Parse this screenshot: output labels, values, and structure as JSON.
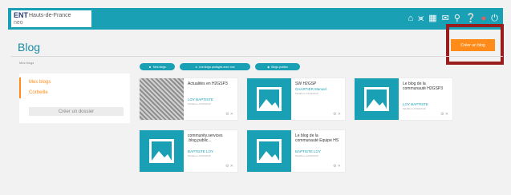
{
  "navbar": {
    "brand": "ENT",
    "region": "Hauts-de-France",
    "sub": "neo",
    "icons": [
      "home-icon",
      "share-icon",
      "apps-grid-icon",
      "messages-icon",
      "search-icon",
      "help-icon",
      "profile-icon",
      "power-icon"
    ]
  },
  "page": {
    "title": "Blog"
  },
  "actions": {
    "create_blog": "Créer un blog"
  },
  "sidebar": {
    "heading": "Mes blogs",
    "items": [
      {
        "label": "Mes blogs",
        "active": true
      },
      {
        "label": "Corbeille"
      }
    ],
    "new_folder": "Créer un dossier"
  },
  "toolbar": {
    "buttons": [
      {
        "label": "Mes blogs",
        "icon": "user-icon"
      },
      {
        "label": "Les blogs partagés avec moi",
        "icon": "share-icon"
      },
      {
        "label": "Blogs publics",
        "icon": "globe-icon"
      }
    ]
  },
  "blogs": [
    {
      "title": "Actualités en H2GSP3",
      "author": "LOY BAPTISTE",
      "date": "Modifié le 04/04/2019",
      "thumb": "photo"
    },
    {
      "title": "SW H2GSP",
      "author": "CHARTIER Manuel",
      "date": "Modifié le 03/04/2019",
      "thumb": "placeholder"
    },
    {
      "title": "Le blog de la communauté H2GSP3",
      "author": "LOY BAPTISTE",
      "date": "Modifié le 03/04/2019",
      "thumb": "placeholder"
    },
    {
      "title": "community.services .blog.public...",
      "author": "BAPTISTE LOY",
      "date": "Modifié le 02/04/2019",
      "thumb": "placeholder"
    },
    {
      "title": "Le blog de la communauté Equipe HS",
      "author": "BAPTISTE LOY",
      "date": "Modifié le 02/04/2019",
      "thumb": "placeholder"
    }
  ],
  "colors": {
    "teal": "#1aa0b4",
    "orange": "#ff8c1a",
    "highlight": "#9b1c1c"
  }
}
